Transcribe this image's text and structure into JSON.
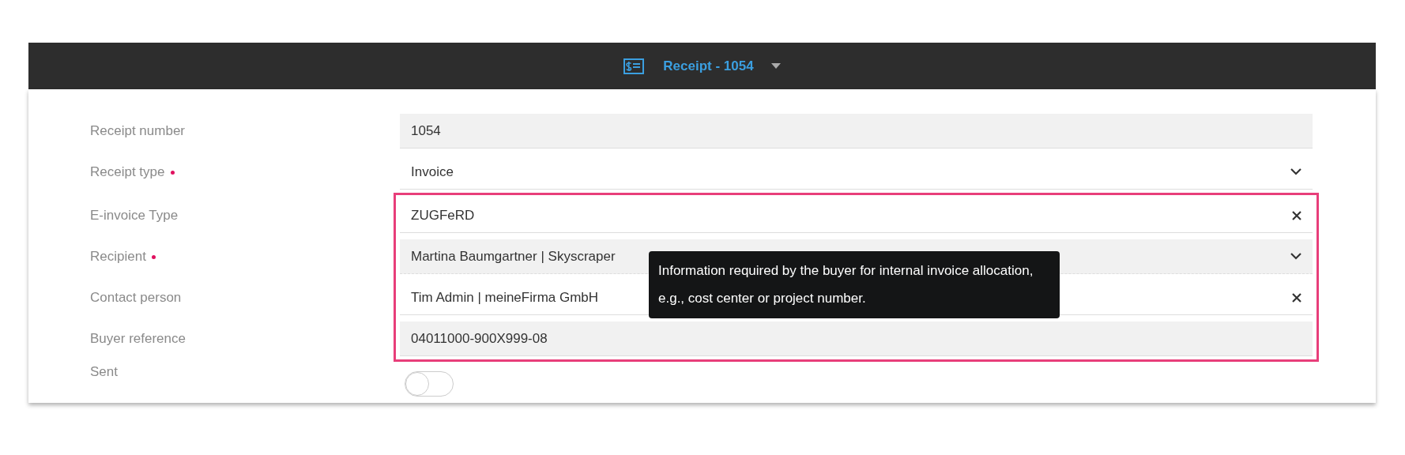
{
  "header": {
    "title": "Receipt - 1054"
  },
  "fields": [
    {
      "label": "Receipt number",
      "required": false,
      "kind": "text",
      "value": "1054",
      "shaded": true
    },
    {
      "label": "Receipt type",
      "required": true,
      "kind": "select",
      "value": "Invoice",
      "shaded": false
    }
  ],
  "highlighted_fields": [
    {
      "label": "E-invoice Type",
      "required": false,
      "kind": "clearable",
      "value": "ZUGFeRD",
      "shaded": false
    },
    {
      "label": "Recipient",
      "required": true,
      "kind": "select",
      "value": "Martina Baumgartner | Skyscraper",
      "shaded": true
    },
    {
      "label": "Contact person",
      "required": false,
      "kind": "clearable",
      "value": "Tim Admin | meineFirma GmbH",
      "shaded": false
    },
    {
      "label": "Buyer reference",
      "required": false,
      "kind": "text",
      "value": "04011000-900X999-08",
      "shaded": true
    }
  ],
  "tooltip": "Information required by the buyer for internal invoice allocation, e.g., cost center or project number.",
  "sent": {
    "label": "Sent",
    "on": false
  }
}
